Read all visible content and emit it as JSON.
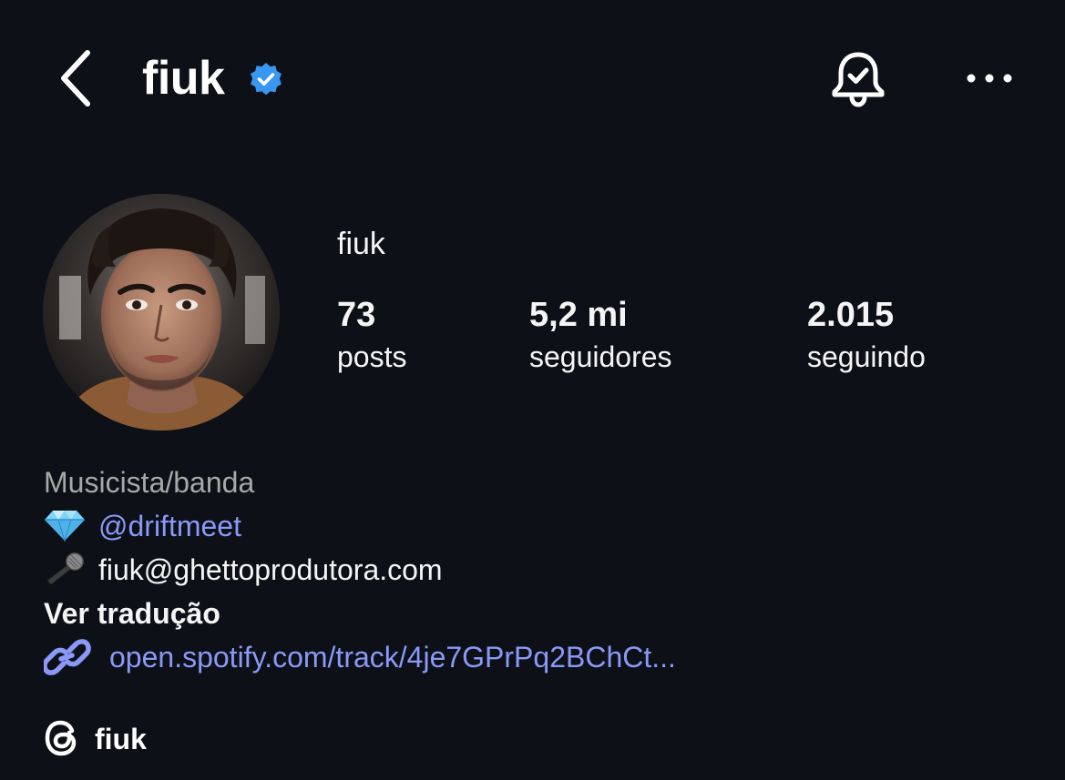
{
  "header": {
    "username": "fiuk",
    "icons": [
      "back-icon",
      "verified-badge-icon",
      "bell-check-icon",
      "more-options-icon"
    ]
  },
  "profile": {
    "display_name": "fiuk",
    "stats": [
      {
        "value": "73",
        "label": "posts"
      },
      {
        "value": "5,2 mi",
        "label": "seguidores"
      },
      {
        "value": "2.015",
        "label": "seguindo"
      }
    ]
  },
  "bio": {
    "category": "Musicista/banda",
    "mention_emoji": "diamond-icon",
    "mention": "@driftmeet",
    "email_emoji": "microphone-icon",
    "email": "fiuk@ghettoprodutora.com",
    "translate": "Ver tradução",
    "link": "open.spotify.com/track/4je7GPrPq2BChCt...",
    "threads_handle": "fiuk"
  },
  "colors": {
    "background": "#0d1017",
    "text": "#f5f5f5",
    "muted": "#a8a8a8",
    "link": "#8a99f7",
    "verified": "#3897f0"
  }
}
